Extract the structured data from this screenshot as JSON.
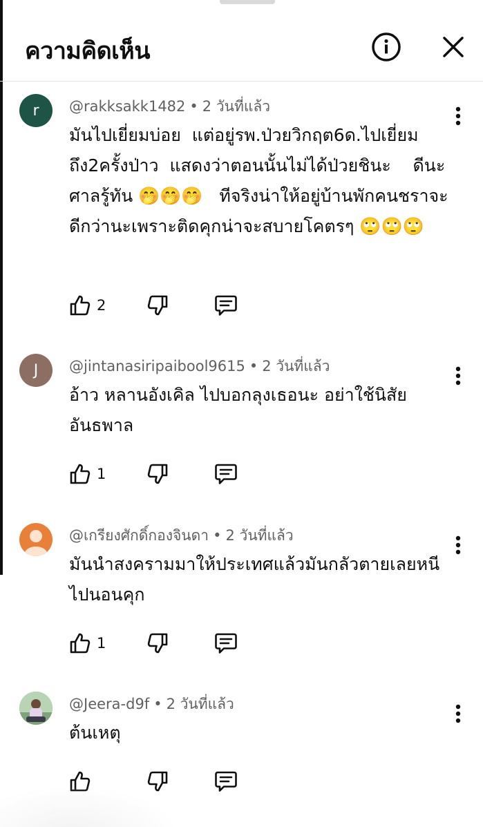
{
  "header": {
    "title": "ความคิดเห็น"
  },
  "comments": [
    {
      "avatar_letter": "r",
      "avatar_color": "#1e5445",
      "author": "@rakksakk1482",
      "time": "2 วันที่แล้ว",
      "text": "มันไปเยี่ยมบ่อย  แต่อยู่รพ.ป่วยวิกฤต6ด.ไปเยี่ยมถึง2ครั้งป่าว  แสดงว่าตอนนั้นไม่ได้ป่วยชินะ    ดีนะศาลรู้ทัน 🤭🤭🤭   ทีจริงน่าให้อยู่บ้านพักคนชราจะดีกว่านะเพราะติดคุกน่าจะสบายโคตรๆ 🙄🙄🙄",
      "likes": "2"
    },
    {
      "avatar_letter": "J",
      "avatar_color": "#8d6e63",
      "author": "@jintanasiripaibool9615",
      "time": "2 วันที่แล้ว",
      "text": "อ้าว หลานอังเคิล ไปบอกลุงเธอนะ อย่าใช้นิสัยอันธพาล",
      "likes": "1"
    },
    {
      "avatar_letter": "",
      "avatar_color": "#e8803a",
      "author": "@เกรียงศักดิ์กองจินดา",
      "time": "2 วันที่แล้ว",
      "text": "มันนำสงครามมาให้ประเทศแล้วมันกลัวตายเลยหนีไปนอนคุก",
      "likes": "1"
    },
    {
      "avatar_letter": "",
      "avatar_color": "#9cb89a",
      "author": "@Jeera-d9f",
      "time": "2 วันที่แล้ว",
      "text": "ต้นเหตุ",
      "likes": ""
    }
  ],
  "icons": {
    "info": "info-icon",
    "close": "close-icon",
    "more": "more-vert-icon",
    "like": "thumb-up-icon",
    "dislike": "thumb-down-icon",
    "reply": "reply-icon"
  }
}
